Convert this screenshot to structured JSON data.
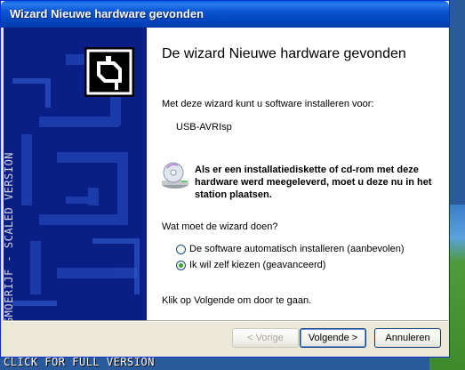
{
  "window": {
    "title": "Wizard Nieuwe hardware gevonden"
  },
  "content": {
    "heading": "De wizard Nieuwe hardware gevonden",
    "intro": "Met deze wizard kunt u software installeren voor:",
    "device": "USB-AVRIsp",
    "info": "Als er een installatiediskette of cd-rom met deze hardware werd meegeleverd, moet u deze nu in het station plaatsen.",
    "question": "Wat moet de wizard doen?",
    "options": [
      {
        "label": "De software automatisch installeren (aanbevolen)",
        "selected": false
      },
      {
        "label": "Ik wil zelf kiezen (geavanceerd)",
        "selected": true
      }
    ],
    "hint": "Klik op Volgende om door te gaan."
  },
  "buttons": {
    "back": "< Vorige",
    "next": "Volgende >",
    "cancel": "Annuleren"
  },
  "watermark": {
    "side": "(C) GMOERIJF - SCALED VERSION",
    "bottom": "CLICK FOR FULL VERSION"
  },
  "colors": {
    "titlebar": "#0a53d0",
    "sidepanel": "#0a1f86",
    "radio_selected": "#3aa82a"
  }
}
